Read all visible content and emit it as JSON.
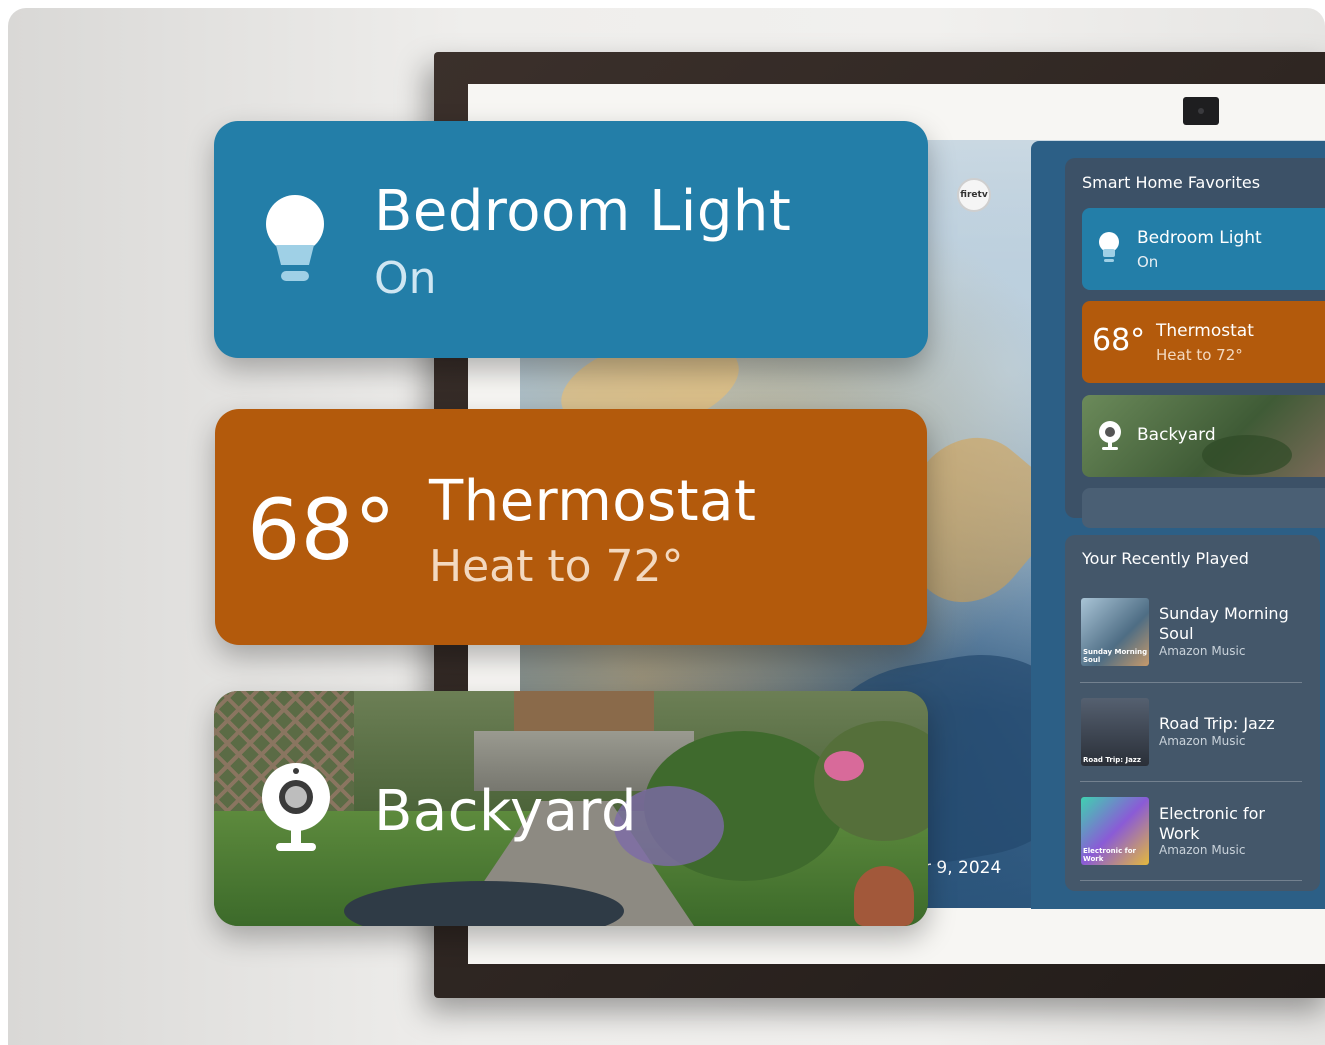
{
  "overlay_tiles": {
    "bedroom_light": {
      "name": "Bedroom Light",
      "status": "On",
      "icon": "lightbulb-icon",
      "color": "#237ea8"
    },
    "thermostat": {
      "temperature": "68°",
      "name": "Thermostat",
      "status": "Heat to 72°",
      "color": "#b35a0c"
    },
    "backyard": {
      "name": "Backyard",
      "icon": "camera-icon"
    }
  },
  "device": {
    "logo_text": "firetv",
    "date_partial": "r 9, 2024"
  },
  "smart_home_favorites": {
    "title": "Smart Home Favorites",
    "items": [
      {
        "name": "Bedroom Light",
        "status": "On"
      },
      {
        "temperature": "68°",
        "name": "Thermostat",
        "status": "Heat to 72°"
      },
      {
        "name": "Backyard"
      }
    ]
  },
  "recently_played": {
    "title": "Your Recently Played",
    "tracks": [
      {
        "title": "Sunday Morning Soul",
        "source": "Amazon Music",
        "art_caption": "Sunday Morning Soul"
      },
      {
        "title": "Road Trip: Jazz",
        "source": "Amazon Music",
        "art_caption": "Road Trip: Jazz"
      },
      {
        "title": "Electronic for Work",
        "source": "Amazon Music",
        "art_caption": "Electronic for Work"
      }
    ]
  }
}
